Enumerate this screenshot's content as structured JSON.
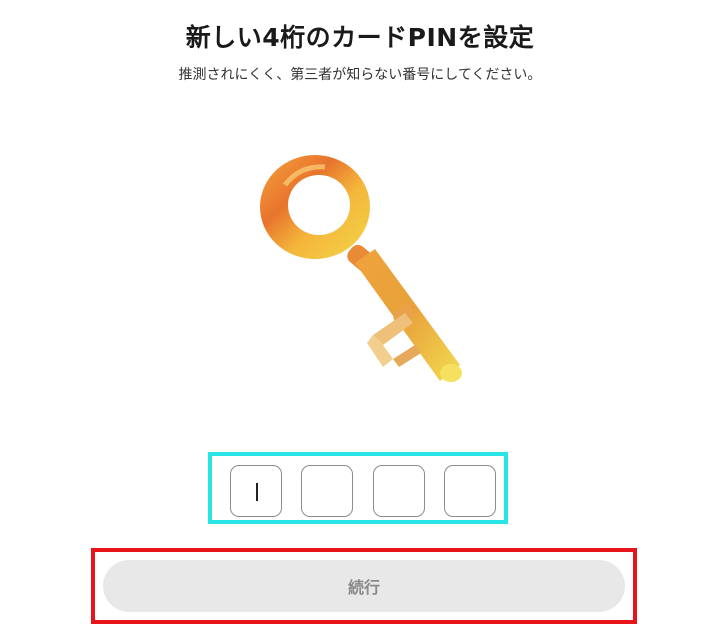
{
  "header": {
    "title": "新しい4桁のカードPINを設定",
    "subtitle": "推測されにくく、第三者が知らない番号にしてください。"
  },
  "illustration": {
    "icon": "key-icon",
    "colors": {
      "gold": "#f4b63a",
      "orange": "#e8742e",
      "yellow": "#f2d64a"
    }
  },
  "pin": {
    "digits": [
      "",
      "",
      "",
      ""
    ],
    "border_color": "#29e6e6"
  },
  "actions": {
    "continue_label": "続行",
    "highlight_color": "#e8141c"
  }
}
